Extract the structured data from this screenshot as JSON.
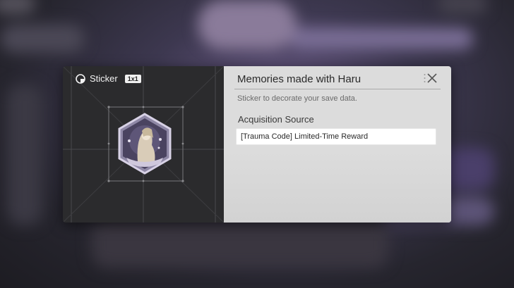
{
  "panel": {
    "title": "Sticker",
    "size_badge": "1x1"
  },
  "item": {
    "name": "Memories made with Haru",
    "description": "Sticker to decorate your save data.",
    "acquisition_title": "Acquisition Source",
    "acquisition_source": "[Trauma Code] Limited-Time Reward"
  },
  "icons": {
    "sticker": "sticker-icon",
    "close": "close-icon"
  },
  "colors": {
    "left_panel": "#2b2b2d",
    "right_panel": "#dcdcdc",
    "source_box": "#ffffff",
    "sticker_frame": "#b9b2cc",
    "sticker_bg": "#4a4360"
  }
}
